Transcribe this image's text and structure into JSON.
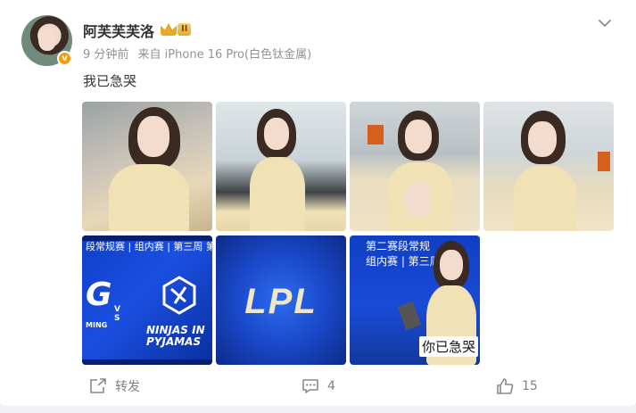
{
  "post": {
    "author": "阿芙芙芙洛",
    "level_badge": "II",
    "verified_badge": "v",
    "time": "9 分钟前",
    "source": "来自 iPhone 16 Pro(白色钛金属)",
    "text": "我已急哭"
  },
  "images": [
    {
      "name": "photo-1"
    },
    {
      "name": "photo-2"
    },
    {
      "name": "photo-3"
    },
    {
      "name": "photo-4"
    },
    {
      "name": "photo-5",
      "banner": "段常规赛 | 组内赛 | 第三周 第二日",
      "vs": "V\nS",
      "logo_text": "NINJAS IN\nPYJAMAS",
      "side_text": "MING"
    },
    {
      "name": "photo-6",
      "logo": "LPL"
    },
    {
      "name": "photo-7",
      "banner": "第二赛段常规\n组内赛 | 第三周 第",
      "caption": "你已急哭"
    }
  ],
  "actions": {
    "repost_label": "转发",
    "comment_count": "4",
    "like_count": "15"
  },
  "colors": {
    "accent_orange": "#f59b12",
    "text_secondary": "#939393",
    "action_gray": "#808080"
  },
  "icons": [
    "chevron-down-icon",
    "repost-icon",
    "comment-icon",
    "like-icon",
    "crown-icon"
  ]
}
